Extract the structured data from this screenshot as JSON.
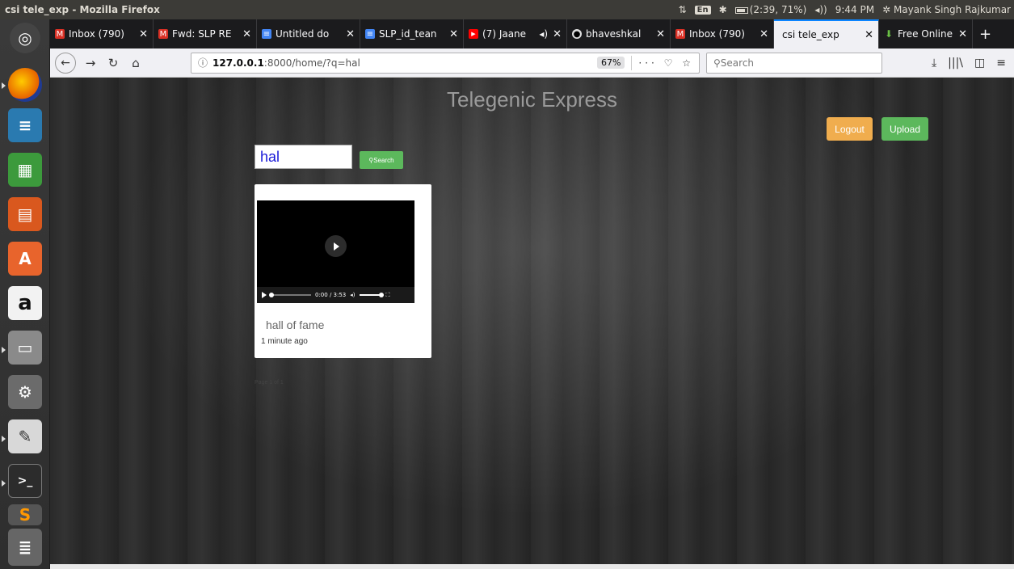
{
  "window": {
    "title": "csi tele_exp - Mozilla Firefox",
    "tray": {
      "lang": "En",
      "battery": "(2:39, 71%)",
      "time": "9:44 PM",
      "user": "Mayank Singh Rajkumar"
    }
  },
  "tabs": [
    {
      "label": "Inbox (790)",
      "icon": "gmail-icon",
      "color": "#d93025"
    },
    {
      "label": "Fwd: SLP RE",
      "icon": "gmail-icon",
      "color": "#d93025"
    },
    {
      "label": "Untitled do",
      "icon": "docs-icon",
      "color": "#4285f4"
    },
    {
      "label": "SLP_id_tean",
      "icon": "docs-icon",
      "color": "#4285f4"
    },
    {
      "label": "(7) Jaane",
      "icon": "youtube-icon",
      "color": "#ff0000"
    },
    {
      "label": "bhaveshkal",
      "icon": "github-icon",
      "color": "#aaaaaa"
    },
    {
      "label": "Inbox (790)",
      "icon": "gmail-icon",
      "color": "#d93025"
    },
    {
      "label": "csi tele_exp",
      "icon": "",
      "color": ""
    },
    {
      "label": "Free Online",
      "icon": "download-icon",
      "color": "#6ac045"
    }
  ],
  "url": {
    "host": "127.0.0.1",
    "rest": ":8000/home/?q=hal",
    "zoom": "67%"
  },
  "searchbar": {
    "placeholder": "Search"
  },
  "page": {
    "title": "Telegenic Express",
    "logout": "Logout",
    "upload": "Upload",
    "query": "hal",
    "search_btn": "Search",
    "result": {
      "title": "hall of fame",
      "time": "1 minute ago",
      "duration": "0:00 / 3:53"
    },
    "pager": "Page 1 of 1"
  },
  "colors": {
    "logout": "#f0ad4e",
    "upload": "#5cb85c",
    "accent": "#0a84ff"
  }
}
